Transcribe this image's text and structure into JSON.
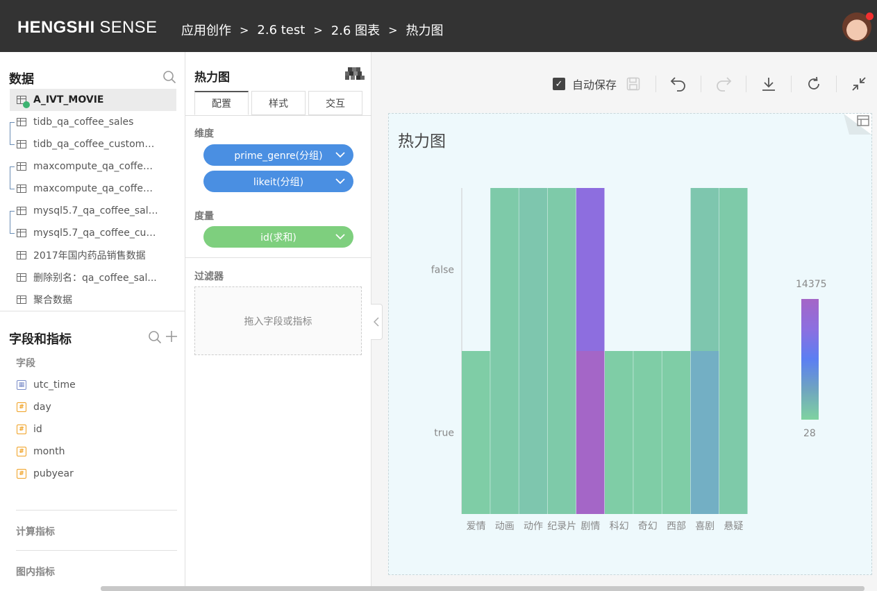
{
  "header": {
    "logo_bold": "HENGSHI",
    "logo_rest": " SENSE",
    "breadcrumb": [
      "应用创作",
      "2.6 test",
      "2.6 图表",
      "热力图"
    ],
    "breadcrumb_sep": ">"
  },
  "data_panel": {
    "title": "数据",
    "datasets": [
      {
        "label": "A_IVT_MOVIE",
        "selected": true
      },
      {
        "label": "tidb_qa_coffee_sales"
      },
      {
        "label": "tidb_qa_coffee_custome..."
      },
      {
        "label": "maxcompute_qa_coffee_..."
      },
      {
        "label": "maxcompute_qa_coffee_..."
      },
      {
        "label": "mysql5.7_qa_coffee_sales"
      },
      {
        "label": "mysql5.7_qa_coffee_cust..."
      },
      {
        "label": "2017年国内药品销售数据"
      },
      {
        "label": "删除别名：qa_coffee_sal..."
      },
      {
        "label": "聚合数据"
      }
    ]
  },
  "fields_panel": {
    "title": "字段和指标",
    "fields_label": "字段",
    "fields": [
      {
        "label": "utc_time",
        "type": "date"
      },
      {
        "label": "day",
        "type": "number"
      },
      {
        "label": "id",
        "type": "number"
      },
      {
        "label": "month",
        "type": "number"
      },
      {
        "label": "pubyear",
        "type": "number"
      }
    ],
    "calc_label": "计算指标",
    "inchart_label": "图内指标"
  },
  "config_panel": {
    "title": "热力图",
    "tabs": [
      "配置",
      "样式",
      "交互"
    ],
    "dimension_label": "维度",
    "dimensions": [
      "prime_genre(分组)",
      "likeit(分组)"
    ],
    "measure_label": "度量",
    "measures": [
      "id(求和)"
    ],
    "filter_label": "过滤器",
    "filter_placeholder": "拖入字段或指标"
  },
  "toolbar": {
    "autosave_label": "自动保存",
    "autosave_checked": true
  },
  "chart_data": {
    "type": "heatmap",
    "title": "热力图",
    "x_categories": [
      "爱情",
      "动画",
      "动作",
      "纪录片",
      "剧情",
      "科幻",
      "奇幻",
      "西部",
      "喜剧",
      "悬疑"
    ],
    "y_categories": [
      "false",
      "true"
    ],
    "value_range": [
      28,
      14375
    ],
    "legend_max": "14375",
    "legend_min": "28",
    "cells": [
      {
        "x": "动画",
        "y": "false",
        "value": 1500
      },
      {
        "x": "动作",
        "y": "false",
        "value": 2300
      },
      {
        "x": "纪录片",
        "y": "false",
        "value": 1500
      },
      {
        "x": "剧情",
        "y": "false",
        "value": 11000
      },
      {
        "x": "喜剧",
        "y": "false",
        "value": 2300
      },
      {
        "x": "悬疑",
        "y": "false",
        "value": 1500
      },
      {
        "x": "爱情",
        "y": "true",
        "value": 1000
      },
      {
        "x": "动画",
        "y": "true",
        "value": 1500
      },
      {
        "x": "动作",
        "y": "true",
        "value": 2300
      },
      {
        "x": "纪录片",
        "y": "true",
        "value": 1500
      },
      {
        "x": "剧情",
        "y": "true",
        "value": 14375
      },
      {
        "x": "科幻",
        "y": "true",
        "value": 1000
      },
      {
        "x": "奇幻",
        "y": "true",
        "value": 1000
      },
      {
        "x": "西部",
        "y": "true",
        "value": 1000
      },
      {
        "x": "喜剧",
        "y": "true",
        "value": 4000
      },
      {
        "x": "悬疑",
        "y": "true",
        "value": 1500
      }
    ],
    "colors": {
      "low": "#7fd3a0",
      "mid": "#5b7ff2",
      "high": "#a466c7",
      "background": "#eef9fc"
    }
  }
}
